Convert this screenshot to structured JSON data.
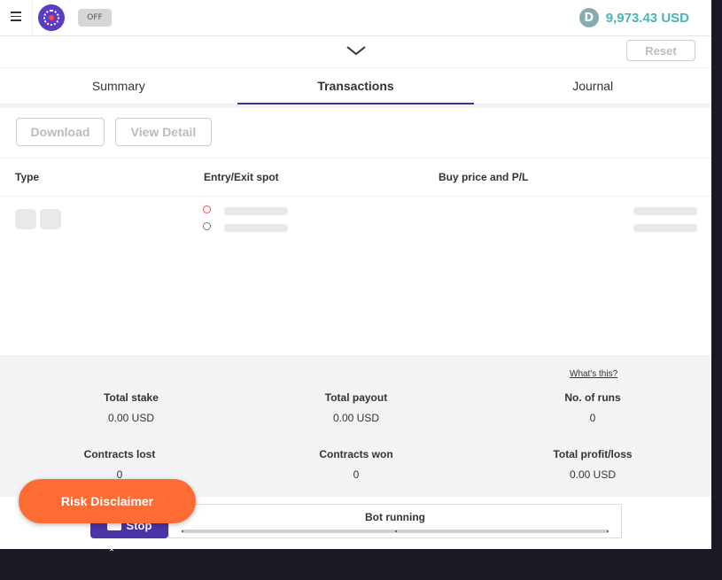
{
  "header": {
    "toggle_label": "OFF",
    "balance": "9,973.43 USD",
    "currency_icon": "deriv-d-icon"
  },
  "toolbar": {
    "reset_label": "Reset"
  },
  "tabs": [
    {
      "label": "Summary",
      "active": false
    },
    {
      "label": "Transactions",
      "active": true
    },
    {
      "label": "Journal",
      "active": false
    }
  ],
  "actions": {
    "download_label": "Download",
    "view_detail_label": "View Detail"
  },
  "table": {
    "columns": [
      "Type",
      "Entry/Exit spot",
      "Buy price and P/L"
    ]
  },
  "stats": {
    "whats_this": "What's this?",
    "items": [
      {
        "label": "Total stake",
        "value": "0.00 USD"
      },
      {
        "label": "Total payout",
        "value": "0.00 USD"
      },
      {
        "label": "No. of runs",
        "value": "0"
      },
      {
        "label": "Contracts lost",
        "value": "0"
      },
      {
        "label": "Contracts won",
        "value": "0"
      },
      {
        "label": "Total profit/loss",
        "value": "0.00 USD"
      }
    ]
  },
  "bottom": {
    "stop_label": "Stop",
    "bot_status": "Bot running",
    "risk_disclaimer": "Risk Disclaimer"
  },
  "colors": {
    "accent": "#3f2f8f",
    "balance": "#4bb4b3",
    "risk": "#ff6b35",
    "stop": "#4b34a8"
  }
}
